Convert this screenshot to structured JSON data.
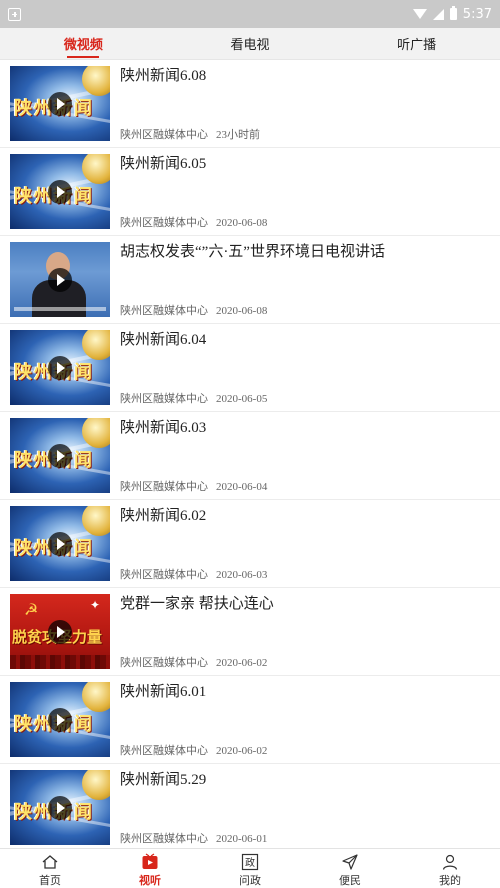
{
  "status_bar": {
    "time": "5:37"
  },
  "tabs": [
    {
      "label": "微视频",
      "active": true
    },
    {
      "label": "看电视",
      "active": false
    },
    {
      "label": "听广播",
      "active": false
    }
  ],
  "items": [
    {
      "title": "陕州新闻6.08",
      "source": "陕州区融媒体中心",
      "date": "23小时前",
      "thumb": "news",
      "thumb_text": "陕州新闻"
    },
    {
      "title": "陕州新闻6.05",
      "source": "陕州区融媒体中心",
      "date": "2020-06-08",
      "thumb": "news",
      "thumb_text": "陕州新闻"
    },
    {
      "title": "胡志权发表“”六·五”世界环境日电视讲话",
      "source": "陕州区融媒体中心",
      "date": "2020-06-08",
      "thumb": "person",
      "thumb_text": ""
    },
    {
      "title": "陕州新闻6.04",
      "source": "陕州区融媒体中心",
      "date": "2020-06-05",
      "thumb": "news",
      "thumb_text": "陕州新闻"
    },
    {
      "title": "陕州新闻6.03",
      "source": "陕州区融媒体中心",
      "date": "2020-06-04",
      "thumb": "news",
      "thumb_text": "陕州新闻"
    },
    {
      "title": "陕州新闻6.02",
      "source": "陕州区融媒体中心",
      "date": "2020-06-03",
      "thumb": "news",
      "thumb_text": "陕州新闻"
    },
    {
      "title": "党群一家亲 帮扶心连心",
      "source": "陕州区融媒体中心",
      "date": "2020-06-02",
      "thumb": "party",
      "thumb_text": "脱贫攻坚力量"
    },
    {
      "title": "陕州新闻6.01",
      "source": "陕州区融媒体中心",
      "date": "2020-06-02",
      "thumb": "news",
      "thumb_text": "陕州新闻"
    },
    {
      "title": "陕州新闻5.29",
      "source": "陕州区融媒体中心",
      "date": "2020-06-01",
      "thumb": "news",
      "thumb_text": "陕州新闻"
    }
  ],
  "bottom_nav": [
    {
      "label": "首页",
      "icon": "home-icon",
      "active": false
    },
    {
      "label": "视听",
      "icon": "tv-icon",
      "active": true
    },
    {
      "label": "问政",
      "icon": "zheng-icon",
      "icon_text": "政",
      "active": false
    },
    {
      "label": "便民",
      "icon": "send-icon",
      "active": false
    },
    {
      "label": "我的",
      "icon": "user-icon",
      "active": false
    }
  ],
  "colors": {
    "accent": "#d8261b",
    "status_bar": "#c9c9c9",
    "tab_bar": "#f2f2f2"
  }
}
